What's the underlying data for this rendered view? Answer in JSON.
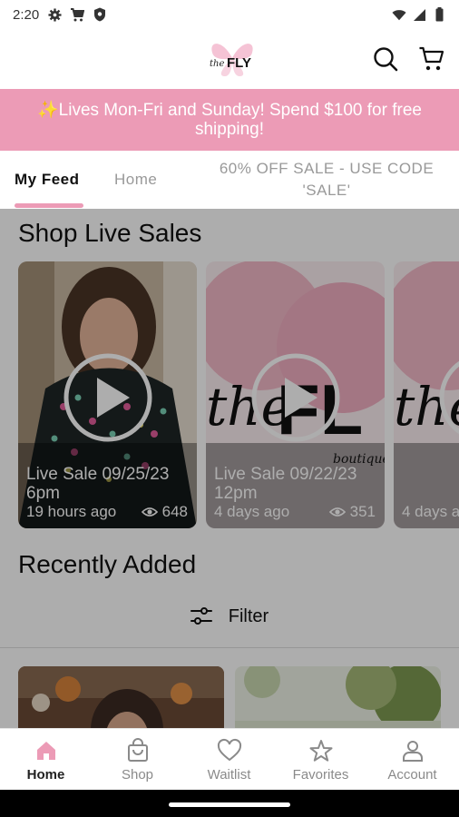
{
  "status_bar": {
    "time": "2:20"
  },
  "header": {
    "logo_text": "FLY",
    "logo_script": "the"
  },
  "banner": {
    "text": "✨Lives Mon-Fri and Sunday! Spend $100 for free shipping!"
  },
  "tabs": [
    {
      "label": "My Feed"
    },
    {
      "label": "Home"
    },
    {
      "label": "60% OFF SALE - USE CODE 'SALE'"
    }
  ],
  "live_sales": {
    "title": "Shop Live Sales",
    "cards": [
      {
        "title": "Live Sale 09/25/23 6pm",
        "time": "19 hours ago",
        "views": "648"
      },
      {
        "title": "Live Sale 09/22/23 12pm",
        "time": "4 days ago",
        "views": "351"
      },
      {
        "title": "",
        "time": "4 days a",
        "views": ""
      }
    ]
  },
  "recently_added": {
    "title": "Recently Added",
    "filter_label": "Filter"
  },
  "bottom_nav": [
    {
      "label": "Home"
    },
    {
      "label": "Shop"
    },
    {
      "label": "Waitlist"
    },
    {
      "label": "Favorites"
    },
    {
      "label": "Account"
    }
  ],
  "colors": {
    "brand_pink": "#ec9bb6"
  }
}
